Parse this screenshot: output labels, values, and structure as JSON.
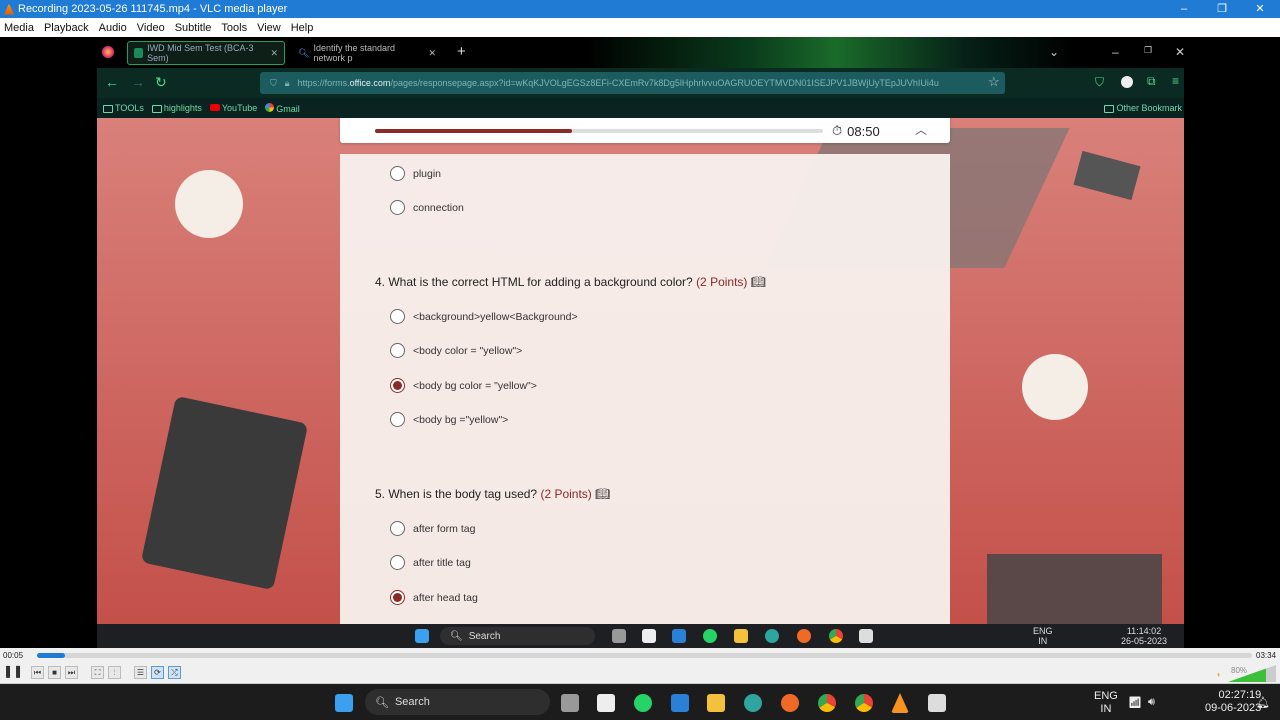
{
  "vlc": {
    "title": "Recording 2023-05-26 111745.mp4 - VLC media player",
    "menu": [
      "Media",
      "Playback",
      "Audio",
      "Video",
      "Subtitle",
      "Tools",
      "View",
      "Help"
    ],
    "time_elapsed": "00:05",
    "time_total": "03:34",
    "seek_fraction": 0.023,
    "volume": "80%",
    "volume_fraction": 0.8
  },
  "browser": {
    "tabs": [
      {
        "label": "IWD Mid Sem Test (BCA-3 Sem)",
        "active": true
      },
      {
        "label": "Identify the standard network p",
        "active": false
      }
    ],
    "url_prefix": "https://forms.",
    "url_domain": "office.com",
    "url_rest": "/pages/responsepage.aspx?id=wKqKJVOLgEGSz8EFi-CXEmRv7k8Dg5lHphrlvvuOAGRUOEYTMVDN01ISEJPV1JBWjUyTEpJUVhIUi4u",
    "bookmarks": [
      "TOOLs",
      "highlights",
      "YouTube",
      "Gmail"
    ],
    "other_bookmarks": "Other Bookmark"
  },
  "form": {
    "progress_fraction": 0.44,
    "timer": "08:50",
    "prev_options": [
      {
        "label": "plugin",
        "selected": false
      },
      {
        "label": "connection",
        "selected": false
      }
    ],
    "questions": [
      {
        "text": "4. What is the correct HTML for adding a background color?",
        "points": "(2 Points)",
        "options": [
          {
            "label": "<background>yellow<Background>",
            "selected": false
          },
          {
            "label": "<body color = \"yellow\">",
            "selected": false
          },
          {
            "label": "<body bg color = \"yellow\">",
            "selected": true
          },
          {
            "label": "<body bg =\"yellow\">",
            "selected": false
          }
        ]
      },
      {
        "text": "5. When is the body tag used?",
        "points": "(2 Points)",
        "options": [
          {
            "label": "after form tag",
            "selected": false
          },
          {
            "label": "after title tag",
            "selected": false
          },
          {
            "label": "after head tag",
            "selected": true
          }
        ]
      }
    ],
    "accent": "#8c2a25"
  },
  "inner_taskbar": {
    "search": "Search",
    "lang": "ENG",
    "region": "IN",
    "time": "11:14:02",
    "date": "26-05-2023"
  },
  "taskbar": {
    "search": "Search",
    "lang": "ENG",
    "region": "IN",
    "time": "02:27:19",
    "date": "09-06-2023"
  }
}
